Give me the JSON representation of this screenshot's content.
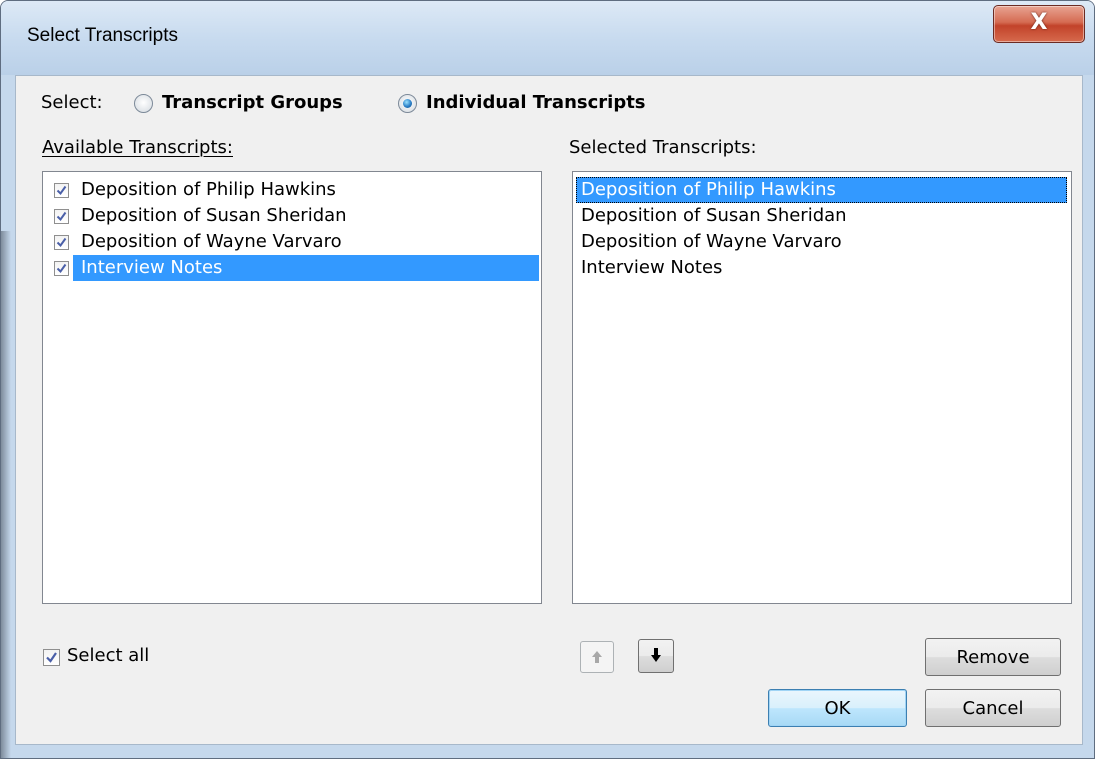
{
  "window": {
    "title": "Select Transcripts",
    "close_label": "X"
  },
  "select_mode": {
    "label": "Select:",
    "options": [
      "Transcript Groups",
      "Individual Transcripts"
    ],
    "selected": "Individual Transcripts"
  },
  "available": {
    "heading": "Available Transcripts:",
    "items": [
      {
        "label": "Deposition of Philip Hawkins",
        "checked": true
      },
      {
        "label": "Deposition of Susan Sheridan",
        "checked": true
      },
      {
        "label": "Deposition of Wayne Varvaro",
        "checked": true
      },
      {
        "label": "Interview Notes",
        "checked": true,
        "selected": true
      }
    ],
    "select_all_label": "Select all",
    "select_all_checked": true
  },
  "selected": {
    "heading": "Selected Transcripts:",
    "items": [
      {
        "label": "Deposition of Philip Hawkins",
        "selected": true
      },
      {
        "label": "Deposition of Susan Sheridan"
      },
      {
        "label": "Deposition of Wayne Varvaro"
      },
      {
        "label": "Interview Notes"
      }
    ],
    "move_up_icon": "arrow-up-icon",
    "move_down_icon": "arrow-down-icon",
    "move_up_enabled": false,
    "move_down_enabled": true,
    "remove_label": "Remove"
  },
  "footer": {
    "ok_label": "OK",
    "cancel_label": "Cancel"
  },
  "colors": {
    "selection": "#3399ff",
    "window_frame": "#c5d8ec",
    "close_button": "#c7452c"
  }
}
